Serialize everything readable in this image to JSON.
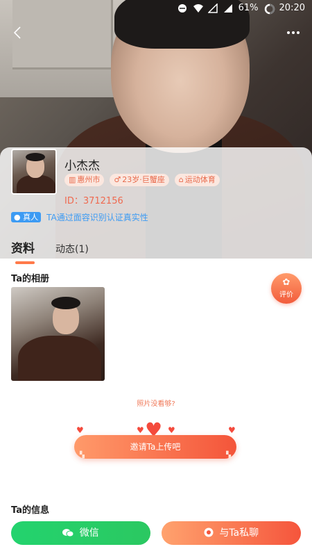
{
  "status_bar": {
    "battery": "61%",
    "time": "20:20"
  },
  "profile": {
    "name": "小杰杰",
    "tags": [
      {
        "icon": "building-icon",
        "glyph": "▥",
        "label": "惠州市"
      },
      {
        "icon": "male-icon",
        "glyph": "♂",
        "label": "23岁·巨蟹座"
      },
      {
        "icon": "briefcase-icon",
        "glyph": "⌂",
        "label": "运动体育"
      }
    ],
    "id_text": "ID：3712156",
    "verified_badge": "真人",
    "verified_text": "TA通过面容识别认证真实性"
  },
  "tabs": [
    {
      "label": "资料",
      "active": true
    },
    {
      "label": "动态(1)",
      "active": false
    }
  ],
  "album": {
    "title": "Ta的相册",
    "not_enough": "照片没看够?",
    "invite_label": "邀请Ta上传吧"
  },
  "rate_button": {
    "label": "评价"
  },
  "info": {
    "title": "Ta的信息"
  },
  "actions": {
    "wechat_label": "微信",
    "chat_label": "与Ta私聊"
  },
  "colors": {
    "accent": "#f4553a",
    "wechat": "#23d36e",
    "verified": "#3d9bf3"
  }
}
